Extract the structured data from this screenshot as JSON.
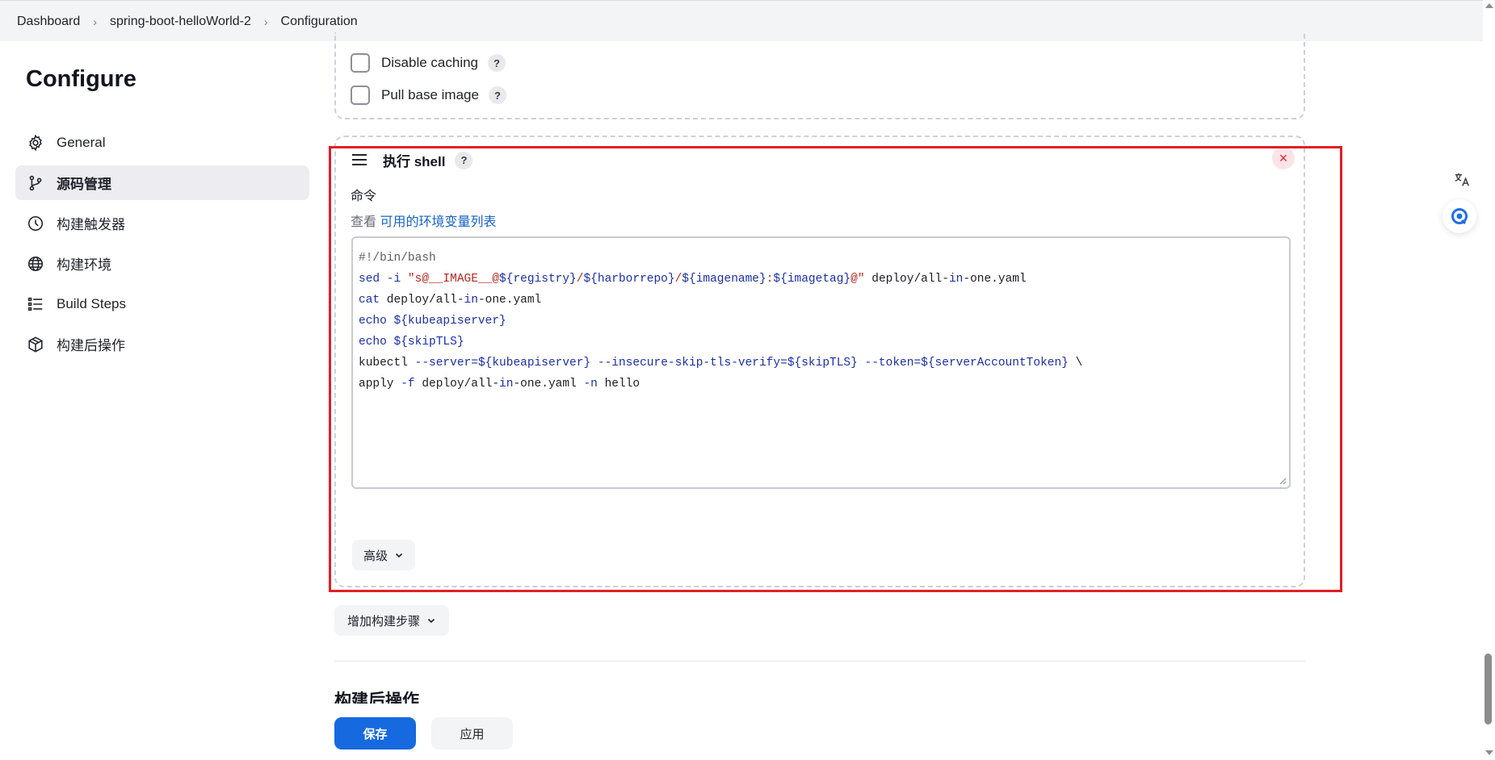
{
  "breadcrumb": {
    "items": [
      "Dashboard",
      "spring-boot-helloWorld-2",
      "Configuration"
    ]
  },
  "page_title": "Configure",
  "sidebar": {
    "items": [
      {
        "label": "General",
        "icon": "gear-icon"
      },
      {
        "label": "源码管理",
        "icon": "branch-icon",
        "active": true
      },
      {
        "label": "构建触发器",
        "icon": "clock-icon"
      },
      {
        "label": "构建环境",
        "icon": "globe-icon"
      },
      {
        "label": "Build Steps",
        "icon": "list-icon"
      },
      {
        "label": "构建后操作",
        "icon": "package-icon"
      }
    ]
  },
  "docker_options": {
    "disable_caching": {
      "label": "Disable caching",
      "checked": false
    },
    "pull_base_image": {
      "label": "Pull base image",
      "checked": false
    },
    "help": "?"
  },
  "shell_step": {
    "title": "执行 shell",
    "help": "?",
    "close": "×",
    "command_label": "命令",
    "env_prefix": "查看",
    "env_link": "可用的环境变量列表",
    "advanced_label": "高级"
  },
  "script": {
    "line1": "#!/bin/bash",
    "line2": {
      "a": "sed -i ",
      "b": "\"s@__IMAGE__@",
      "c": "${registry}",
      "d": "/",
      "e": "${harborrepo}",
      "f": "/",
      "g": "${imagename}",
      "h": ":",
      "i": "${imagetag}",
      "j": "@\"",
      "k": " deploy/all-",
      "l": "in",
      "m": "-one.yaml"
    },
    "line3": {
      "a": "cat",
      "b": " deploy/all-",
      "c": "in",
      "d": "-one.yaml"
    },
    "line4": {
      "a": "echo",
      "b": " ${kubeapiserver}"
    },
    "line5": {
      "a": "echo",
      "b": " ${skipTLS}"
    },
    "line6": {
      "a": "kubectl ",
      "b": "--server=${kubeapiserver}",
      "c": " ",
      "d": "--insecure-skip-tls-verify=${skipTLS}",
      "e": " ",
      "f": "--token=${serverAccountToken}",
      "g": " \\"
    },
    "line7": {
      "a": "apply ",
      "b": "-f",
      "c": " deploy/all-",
      "d": "in",
      "e": "-one.yaml ",
      "f": "-n",
      "g": " hello"
    }
  },
  "add_step_label": "增加构建步骤",
  "post_build_heading": "构建后操作",
  "footer": {
    "save_label": "保存",
    "apply_label": "应用"
  },
  "floating": {
    "translate_icon": "translate-icon",
    "assistant_icon": "assistant-icon"
  },
  "colors": {
    "accent": "#1769e0",
    "highlight_frame": "#e11f25",
    "link": "#1763c6"
  }
}
